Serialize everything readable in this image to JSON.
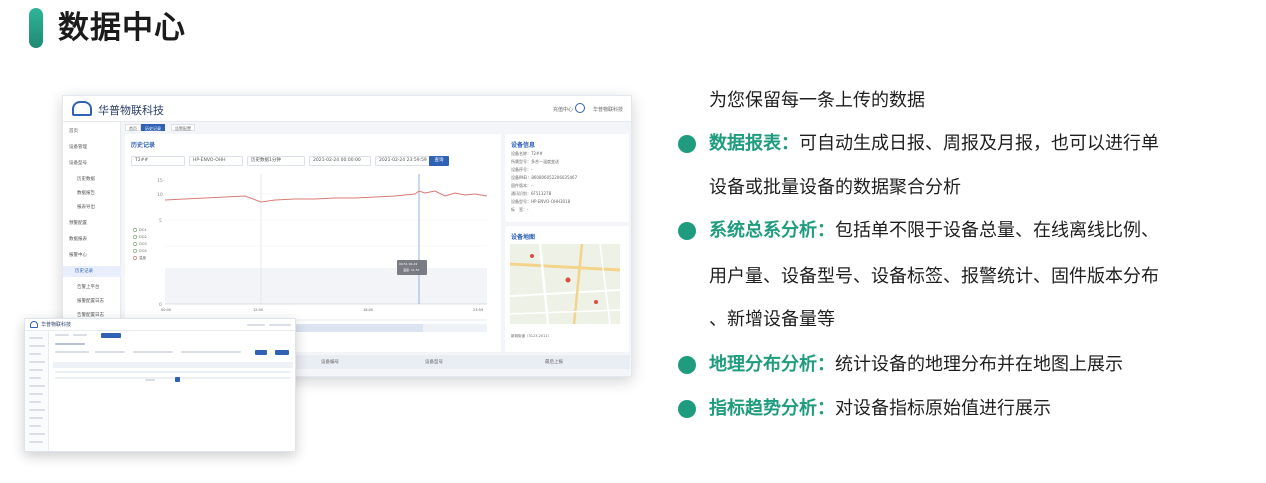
{
  "page": {
    "title": "数据中心"
  },
  "features": {
    "intro": "为您保留每一条上传的数据",
    "items": [
      {
        "label": "数据报表：",
        "text": "可自动生成日报、周报及月报，也可以进行单",
        "cont": "设备或批量设备的数据聚合分析"
      },
      {
        "label": "系统总系分析：",
        "text": "包括单不限于设备总量、在线离线比例、",
        "cont": "用户量、设备型号、设备标签、报警统计、固件版本分布",
        "cont2": "、新增设备量等"
      },
      {
        "label": "地理分布分析：",
        "text": "统计设备的地理分布并在地图上展示"
      },
      {
        "label": "指标趋势分析：",
        "text": "对设备指标原始值进行展示"
      }
    ],
    "bullet_color": "#1f9c7e"
  },
  "screenshot": {
    "brand": "华普物联科技",
    "top_link": "充值中心",
    "top_user": "华普物联科技",
    "sidebar": [
      "首页",
      "设备管理",
      "设备型号",
      "历史数据",
      "数据报告",
      "报表导出",
      "预警配置",
      "数据报表",
      "报警中心",
      "历史记录",
      "告警上平台",
      "报警配置日志",
      "告警配置日志"
    ],
    "sidebar_active": "历史记录",
    "tabs": [
      "首页",
      "历史记录",
      "告警配置"
    ],
    "history": {
      "title": "历史记录",
      "device": "T2##",
      "model": "HP-ENVO-OHH",
      "interval": "历史数据1分钟",
      "start": "2021-02-24 00:00:00",
      "end": "2021-02-24 23:59:59",
      "query": "查询"
    },
    "legend": [
      "DO1",
      "DO2",
      "DO3",
      "DO4",
      "温度"
    ],
    "tooltip": {
      "time": "09:51 02-24",
      "value": "温度: 11.57"
    },
    "x_ticks": [
      "00:00",
      "12:00",
      "18:00",
      "23:59"
    ],
    "device_info": {
      "title": "设备信息",
      "rows": [
        "设备名称：T2##",
        "所属型号：多合一温度变送",
        "设备序号：-",
        "设备IMEI：860806052206035467",
        "固件版本：-",
        "通讯识别：6F51327B",
        "设备型号：HP-ENVO-OHH3018",
        "标　签：-"
      ]
    },
    "map": {
      "title": "设备地图",
      "location": "新城街道（3123-2011）"
    },
    "bottom_cols": [
      "设备编号",
      "设备型号",
      "最后上报"
    ]
  }
}
